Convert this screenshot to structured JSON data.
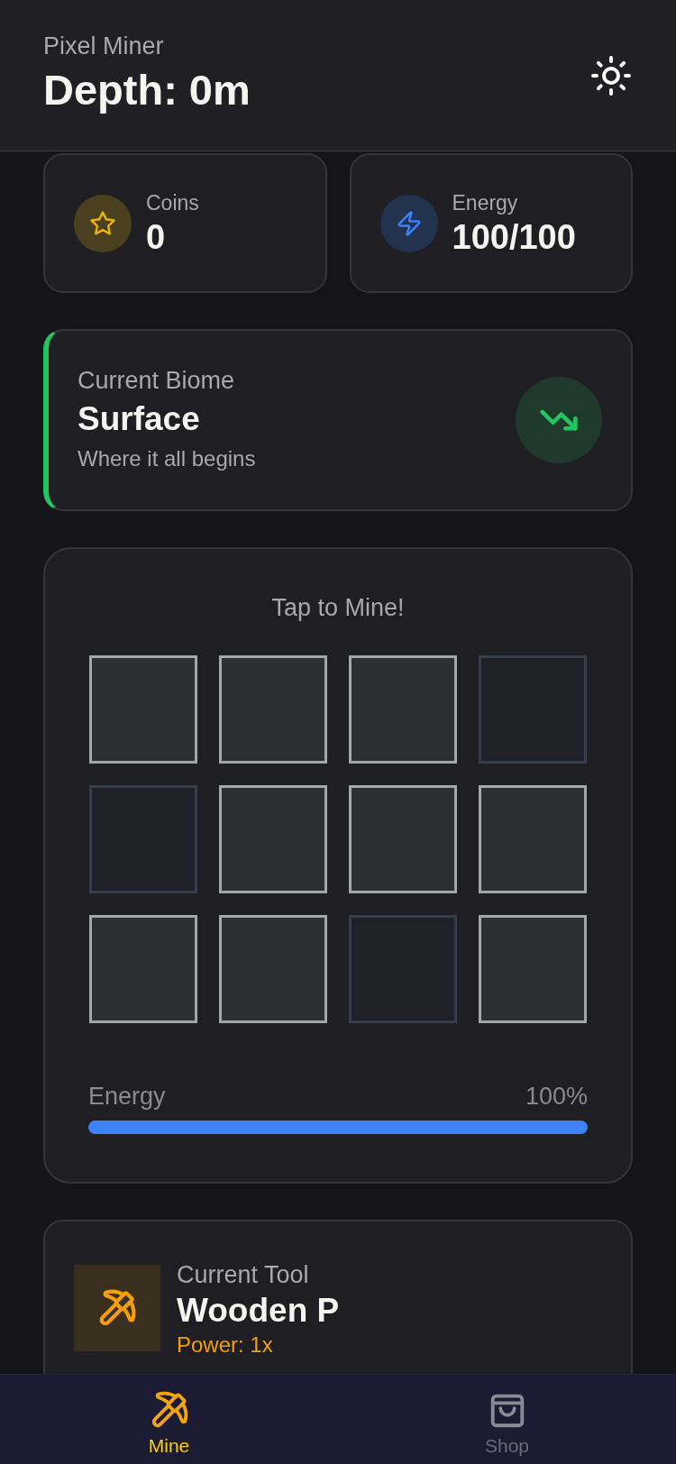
{
  "header": {
    "subtitle": "Pixel Miner",
    "title": "Depth: 0m"
  },
  "stats": [
    {
      "label": "Coins",
      "value": "0"
    },
    {
      "label": "Energy",
      "value": "100/100"
    }
  ],
  "biome": {
    "label": "Current Biome",
    "name": "Surface",
    "description": "Where it all begins"
  },
  "mine": {
    "prompt": "Tap to Mine!",
    "tiles": [
      {
        "kind": "block"
      },
      {
        "kind": "block"
      },
      {
        "kind": "block"
      },
      {
        "kind": "empty"
      },
      {
        "kind": "empty"
      },
      {
        "kind": "block"
      },
      {
        "kind": "block"
      },
      {
        "kind": "block"
      },
      {
        "kind": "block"
      },
      {
        "kind": "block"
      },
      {
        "kind": "empty"
      },
      {
        "kind": "block"
      }
    ],
    "energy": {
      "label": "Energy",
      "reading": "100%",
      "level": 1
    }
  },
  "tool": {
    "label": "Current Tool",
    "name": "Wooden P",
    "power": "Power: 1x"
  },
  "nav": [
    {
      "label": "Mine",
      "selected": true
    },
    {
      "label": "Shop",
      "selected": false
    }
  ]
}
